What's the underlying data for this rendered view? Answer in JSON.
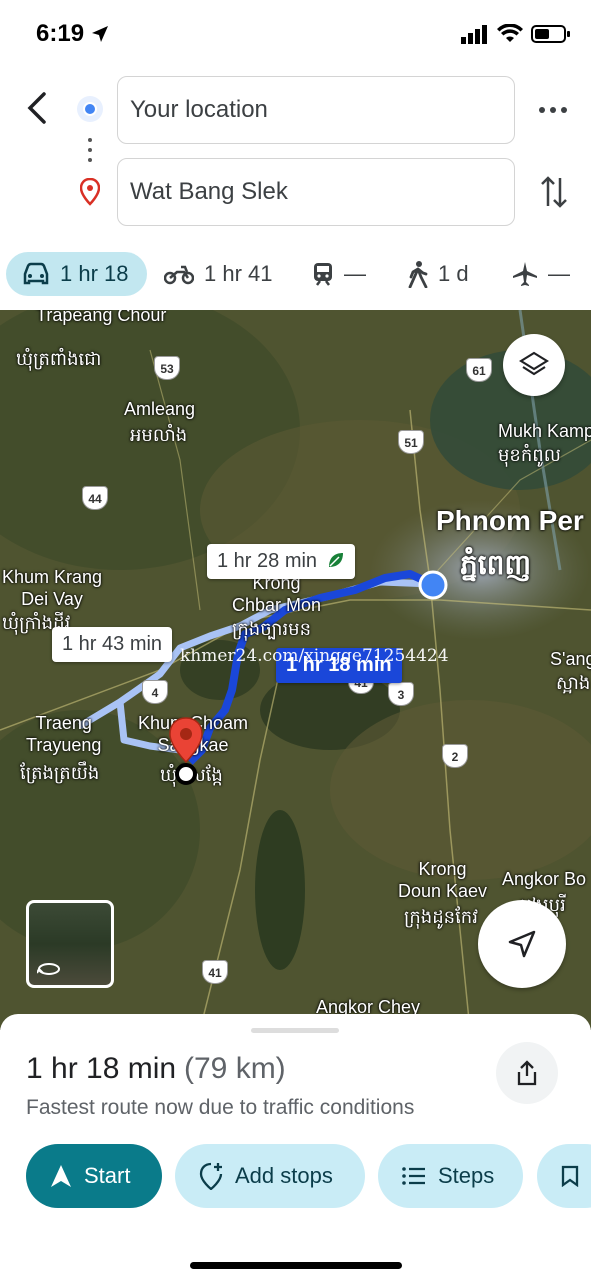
{
  "status_bar": {
    "time": "6:19"
  },
  "directions": {
    "origin": "Your location",
    "destination": "Wat Bang Slek"
  },
  "modes": [
    {
      "icon": "car-icon",
      "label": "1 hr 18",
      "active": true
    },
    {
      "icon": "motorcycle-icon",
      "label": "1 hr 41"
    },
    {
      "icon": "transit-icon",
      "label": "—"
    },
    {
      "icon": "walk-icon",
      "label": "1 d"
    },
    {
      "icon": "flight-icon",
      "label": "—"
    }
  ],
  "map": {
    "labels": {
      "trapeang_chour": "Trapeang\nChour",
      "trapeang_chour_km": "ឃុំត្រពាំងជោ",
      "amleang": "Amleang",
      "amleang_km": "អមលាំង",
      "mukh_kampul": "Mukh Kamp",
      "mukh_kampul_km": "មុខកំពូល",
      "phnom_penh": "Phnom Per",
      "phnom_penh_km": "ភ្នំពេញ",
      "khum_krang": "Khum Krang\nDei Vay",
      "khum_krang_km": "ឃុំក្រាំងដីវ",
      "chbar_mon": "Krong\nChbar Mon",
      "chbar_mon_km": "ក្រុងច្បារមន",
      "sang": "S'ang",
      "sang_km": "ស្អាង",
      "traeng": "Traeng\nTrayueng",
      "traeng_km": "ត្រែងត្រយឹង",
      "khum_choam": "Khum Choam\nSangkae",
      "khum_choam_km": "ឃុំចំសង្កែ",
      "doun_kaev": "Krong\nDoun Kaev",
      "doun_kaev_km": "ក្រុងដូនកែវ",
      "angkor_borei": "Angkor Bo",
      "angkor_borei_km": "អង្គរបុរី",
      "angkor_chey": "Angkor Chey"
    },
    "routes": {
      "alt1": "1 hr 28 min",
      "alt2": "1 hr 43 min",
      "primary": "1 hr 18 min"
    },
    "watermark": "khmer24.com/xingge71254424",
    "shields": [
      "53",
      "61",
      "51",
      "44",
      "4",
      "41",
      "3",
      "2",
      "41"
    ]
  },
  "summary": {
    "duration": "1 hr 18 min",
    "distance": "(79 km)",
    "note": "Fastest route now due to traffic conditions"
  },
  "actions": {
    "start": "Start",
    "add_stops": "Add stops",
    "steps": "Steps"
  },
  "colors": {
    "primary_route": "#1a47d9",
    "alt_route": "#a9c3f5",
    "accent": "#0a7b8a",
    "chip": "#c9ecf6"
  }
}
